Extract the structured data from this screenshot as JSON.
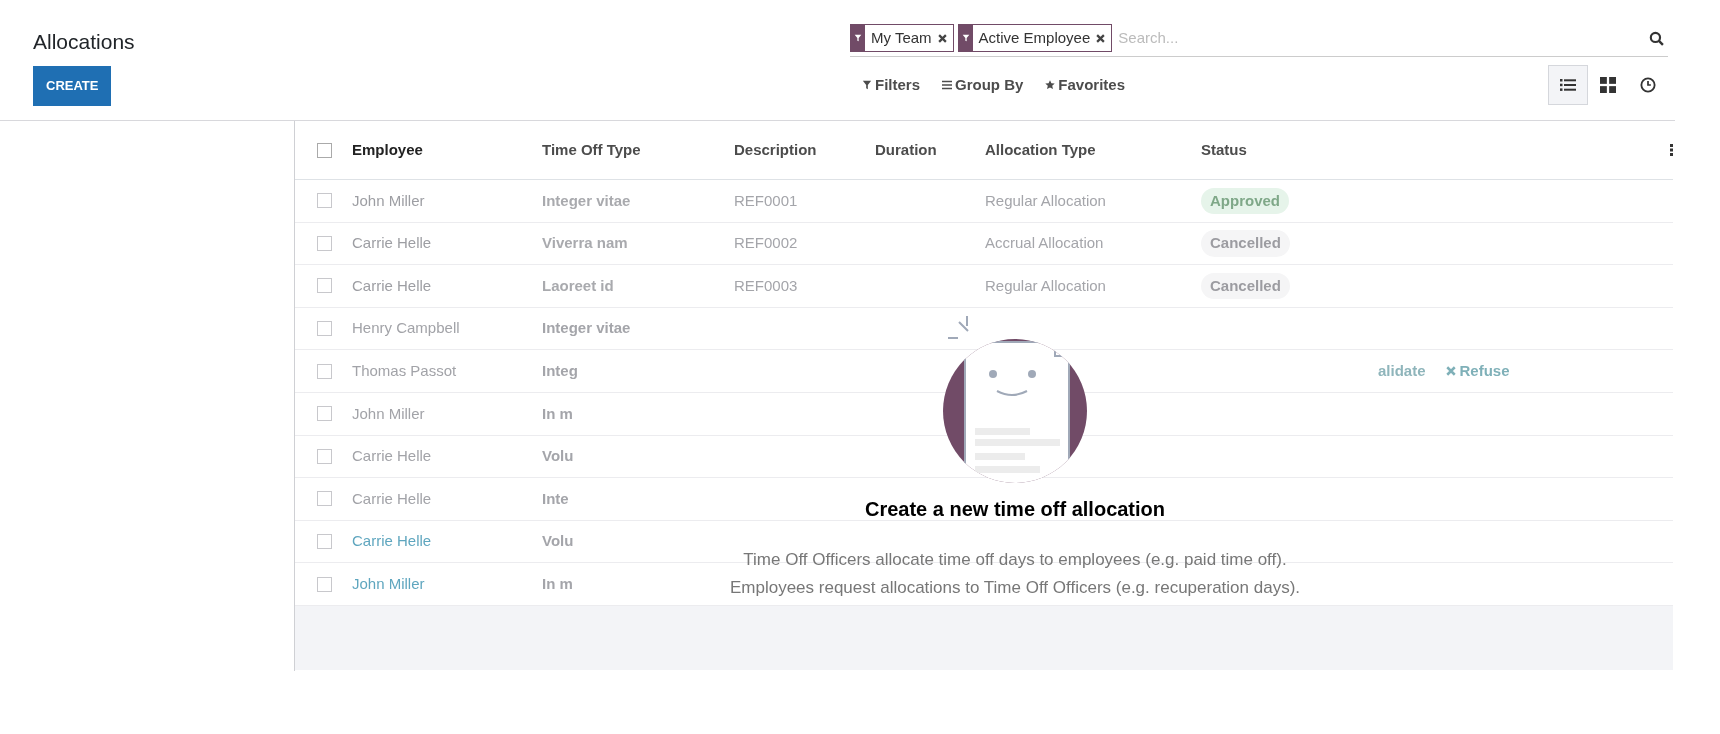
{
  "title": "Allocations",
  "create_button": "CREATE",
  "search": {
    "facets": [
      {
        "label": "My Team"
      },
      {
        "label": "Active Employee"
      }
    ],
    "placeholder": "Search..."
  },
  "search_options": [
    "Filters",
    "Group By",
    "Favorites"
  ],
  "views": [
    {
      "kind": "list",
      "selected": true
    },
    {
      "kind": "kanban",
      "selected": false
    },
    {
      "kind": "activity",
      "selected": false
    }
  ],
  "table": {
    "select_all_checked": false,
    "columns": [
      "Employee",
      "Time Off Type",
      "Description",
      "Duration",
      "Allocation Type",
      "Status"
    ],
    "rows": [
      {
        "employee": "John Miller",
        "checked": false,
        "color": "#9d9ea3",
        "time_off_type": "Integer vitae",
        "description": "REF0001",
        "allocation_type": "Regular Allocation",
        "status": {
          "text": "Approved",
          "kind": "approved"
        }
      },
      {
        "employee": "Carrie Helle",
        "checked": false,
        "color": "#9d9ea3",
        "time_off_type": "Viverra nam",
        "description": "REF0002",
        "allocation_type": "Accrual Allocation",
        "status": {
          "text": "Cancelled",
          "kind": "cancelled"
        }
      },
      {
        "employee": "Carrie Helle",
        "checked": false,
        "color": "#9d9ea3",
        "time_off_type": "Laoreet id",
        "description": "REF0003",
        "allocation_type": "Regular Allocation",
        "status": {
          "text": "Cancelled",
          "kind": "cancelled"
        }
      },
      {
        "employee": "Henry Campbell",
        "checked": false,
        "color": "#a2a3a8",
        "time_off_type": "Integer vitae"
      },
      {
        "employee": "Thomas Passot",
        "checked": false,
        "color": "#a2a3a8",
        "time_off_type": "Integ",
        "actions": [
          "alidate",
          "Refuse"
        ]
      },
      {
        "employee": "John Miller",
        "checked": false,
        "color": "#a2a3a8",
        "time_off_type": "In m"
      },
      {
        "employee": "Carrie Helle",
        "checked": false,
        "color": "#a2a3a8",
        "time_off_type": "Volu"
      },
      {
        "employee": "Carrie Helle",
        "checked": false,
        "color": "#a2a3a8",
        "time_off_type": "Inte"
      },
      {
        "employee": "Carrie Helle",
        "checked": false,
        "color": "#5fa6bf",
        "time_off_type": "Volu"
      },
      {
        "employee": "John Miller",
        "checked": false,
        "color": "#5fa6bf",
        "time_off_type": "In m"
      }
    ]
  },
  "empty_state": {
    "title": "Create a new time off allocation",
    "lines": [
      "Time Off Officers allocate time off days to employees (e.g. paid time off).",
      "Employees request allocations to Time Off Officers (e.g. recuperation days)."
    ]
  }
}
